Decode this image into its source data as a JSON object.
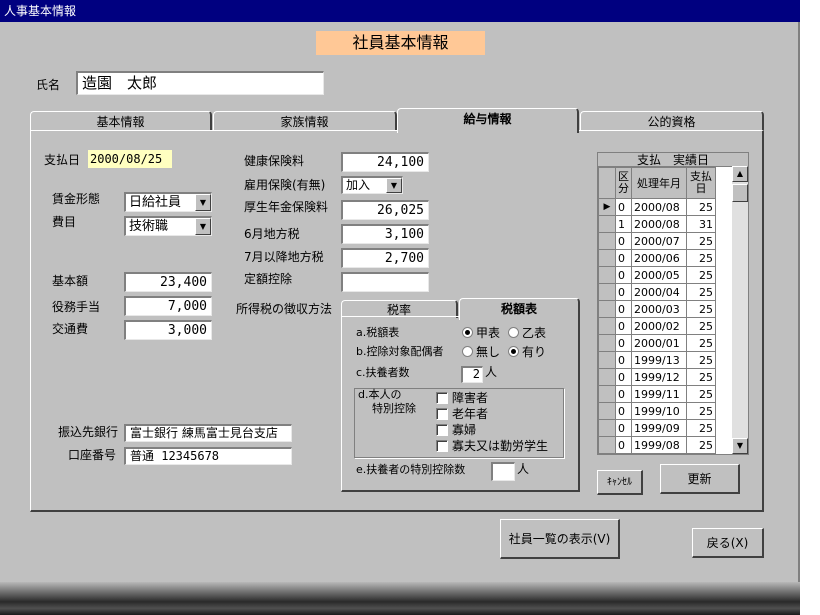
{
  "window": {
    "title": "人事基本情報"
  },
  "header": {
    "title": "社員基本情報"
  },
  "employee": {
    "name_label": "氏名",
    "name_value": "造園　太郎"
  },
  "tabs": [
    {
      "label": "基本情報",
      "active": false
    },
    {
      "label": "家族情報",
      "active": false
    },
    {
      "label": "給与情報",
      "active": true
    },
    {
      "label": "公的資格",
      "active": false
    }
  ],
  "salary": {
    "pay_date_label": "支払日",
    "pay_date_value": "2000/08/25",
    "wage_type_label": "賃金形態",
    "wage_type_value": "日給社員",
    "expense_label": "費目",
    "expense_value": "技術職",
    "base_label": "基本額",
    "base_value": "23,400",
    "position_allowance_label": "役務手当",
    "position_allowance_value": "7,000",
    "transport_label": "交通費",
    "transport_value": "3,000",
    "bank_label": "振込先銀行",
    "bank_value": "富士銀行 練馬富士見台支店",
    "account_label": "口座番号",
    "account_value": "普通 12345678"
  },
  "deductions": {
    "health_label": "健康保険料",
    "health_value": "24,100",
    "employment_label": "雇用保険(有無)",
    "employment_value": "加入",
    "pension_label": "厚生年金保険料",
    "pension_value": "26,025",
    "june_tax_label": "6月地方税",
    "june_tax_value": "3,100",
    "july_tax_label": "7月以降地方税",
    "july_tax_value": "2,700",
    "fixed_label": "定額控除",
    "fixed_value": "",
    "method_label": "所得税の徴収方法"
  },
  "tax_tabs": [
    {
      "label": "税率",
      "active": false
    },
    {
      "label": "税額表",
      "active": true
    }
  ],
  "tax": {
    "a_label": "a.税額表",
    "a_opt1": "甲表",
    "a_opt2": "乙表",
    "b_label": "b.控除対象配偶者",
    "b_opt1": "無し",
    "b_opt2": "有り",
    "c_label": "c.扶養者数",
    "c_value": "2",
    "c_unit": "人",
    "d_label_1": "d.本人の",
    "d_label_2": "特別控除",
    "d_checks": [
      "障害者",
      "老年者",
      "寡婦",
      "寡夫又は勤労学生"
    ],
    "e_label": "e.扶養者の特別控除数",
    "e_value": "",
    "e_unit": "人"
  },
  "history": {
    "title": "支払　実績日",
    "col_kubun": "区分",
    "col_period": "処理年月",
    "col_day": "支払日",
    "rows": [
      {
        "kubun": "0",
        "period": "2000/08",
        "day": "25"
      },
      {
        "kubun": "1",
        "period": "2000/08",
        "day": "31"
      },
      {
        "kubun": "0",
        "period": "2000/07",
        "day": "25"
      },
      {
        "kubun": "0",
        "period": "2000/06",
        "day": "25"
      },
      {
        "kubun": "0",
        "period": "2000/05",
        "day": "25"
      },
      {
        "kubun": "0",
        "period": "2000/04",
        "day": "25"
      },
      {
        "kubun": "0",
        "period": "2000/03",
        "day": "25"
      },
      {
        "kubun": "0",
        "period": "2000/02",
        "day": "25"
      },
      {
        "kubun": "0",
        "period": "2000/01",
        "day": "25"
      },
      {
        "kubun": "0",
        "period": "1999/13",
        "day": "25"
      },
      {
        "kubun": "0",
        "period": "1999/12",
        "day": "25"
      },
      {
        "kubun": "0",
        "period": "1999/11",
        "day": "25"
      },
      {
        "kubun": "0",
        "period": "1999/10",
        "day": "25"
      },
      {
        "kubun": "0",
        "period": "1999/09",
        "day": "25"
      },
      {
        "kubun": "0",
        "period": "1999/08",
        "day": "25"
      }
    ]
  },
  "buttons": {
    "cancel": "ｷｬﾝｾﾙ",
    "update": "更新",
    "employee_list": "社員一覧の表示(V)",
    "back": "戻る(X)"
  }
}
